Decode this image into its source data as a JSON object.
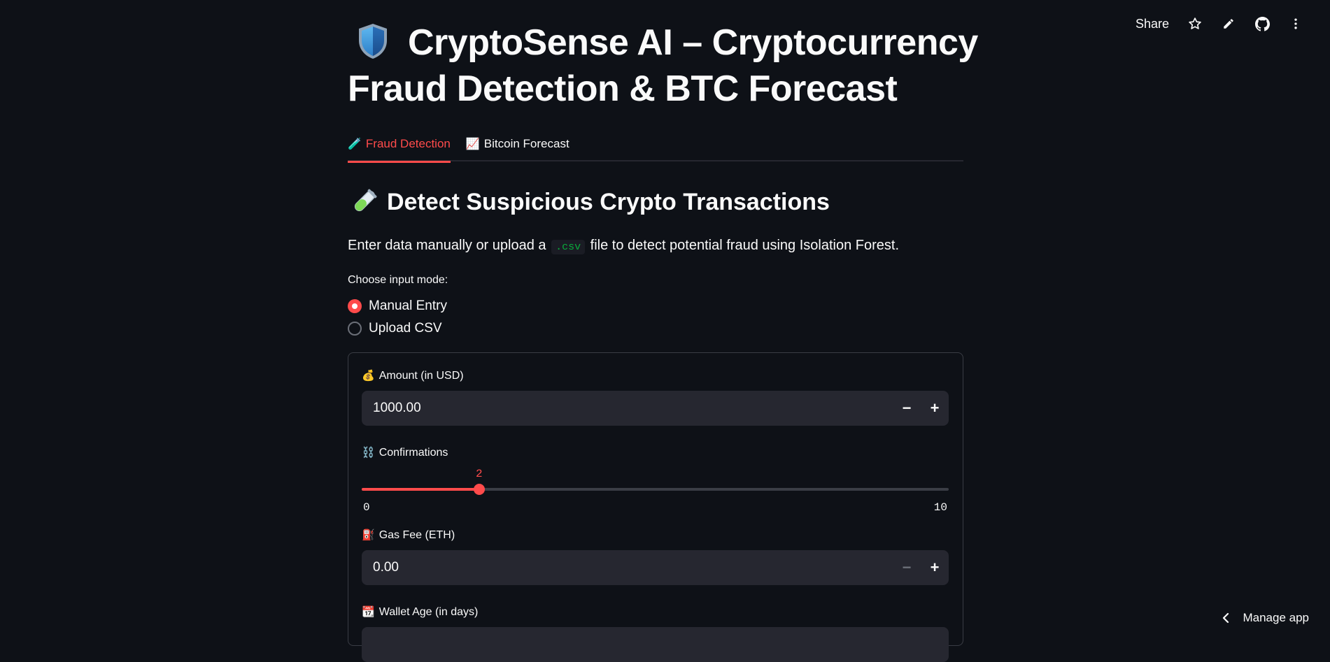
{
  "toolbar": {
    "share_label": "Share",
    "icons": [
      "star-icon",
      "pencil-icon",
      "github-icon",
      "more-vertical-icon"
    ]
  },
  "title": {
    "line1": "CryptoSense AI – Cryptocurrency",
    "line2": "Fraud Detection & BTC Forecast"
  },
  "tabs": [
    {
      "emoji": "🧪",
      "label": "Fraud Detection",
      "active": true
    },
    {
      "emoji": "📈",
      "label": "Bitcoin Forecast",
      "active": false
    }
  ],
  "section": {
    "heading": "Detect Suspicious Crypto Transactions",
    "desc_before": "Enter data manually or upload a",
    "desc_code": ".csv",
    "desc_after": "file to detect potential fraud using Isolation Forest."
  },
  "input_mode": {
    "label": "Choose input mode:",
    "options": [
      "Manual Entry",
      "Upload CSV"
    ],
    "selected": "Manual Entry"
  },
  "form": {
    "amount": {
      "emoji": "💰",
      "label": "Amount (in USD)",
      "value": "1000.00"
    },
    "confirmations": {
      "emoji": "⛓️",
      "label": "Confirmations",
      "value": "2",
      "min": "0",
      "max": "10",
      "fraction": 0.2
    },
    "gas_fee": {
      "emoji": "⛽",
      "label": "Gas Fee (ETH)",
      "value": "0.00"
    },
    "wallet_age": {
      "emoji": "📆",
      "label": "Wallet Age (in days)"
    }
  },
  "manage_app": {
    "label": "Manage app"
  },
  "colors": {
    "background": "#0e1117",
    "accent": "#ff4b4b",
    "input_bg": "#262730",
    "code_green": "#09ab3b"
  }
}
